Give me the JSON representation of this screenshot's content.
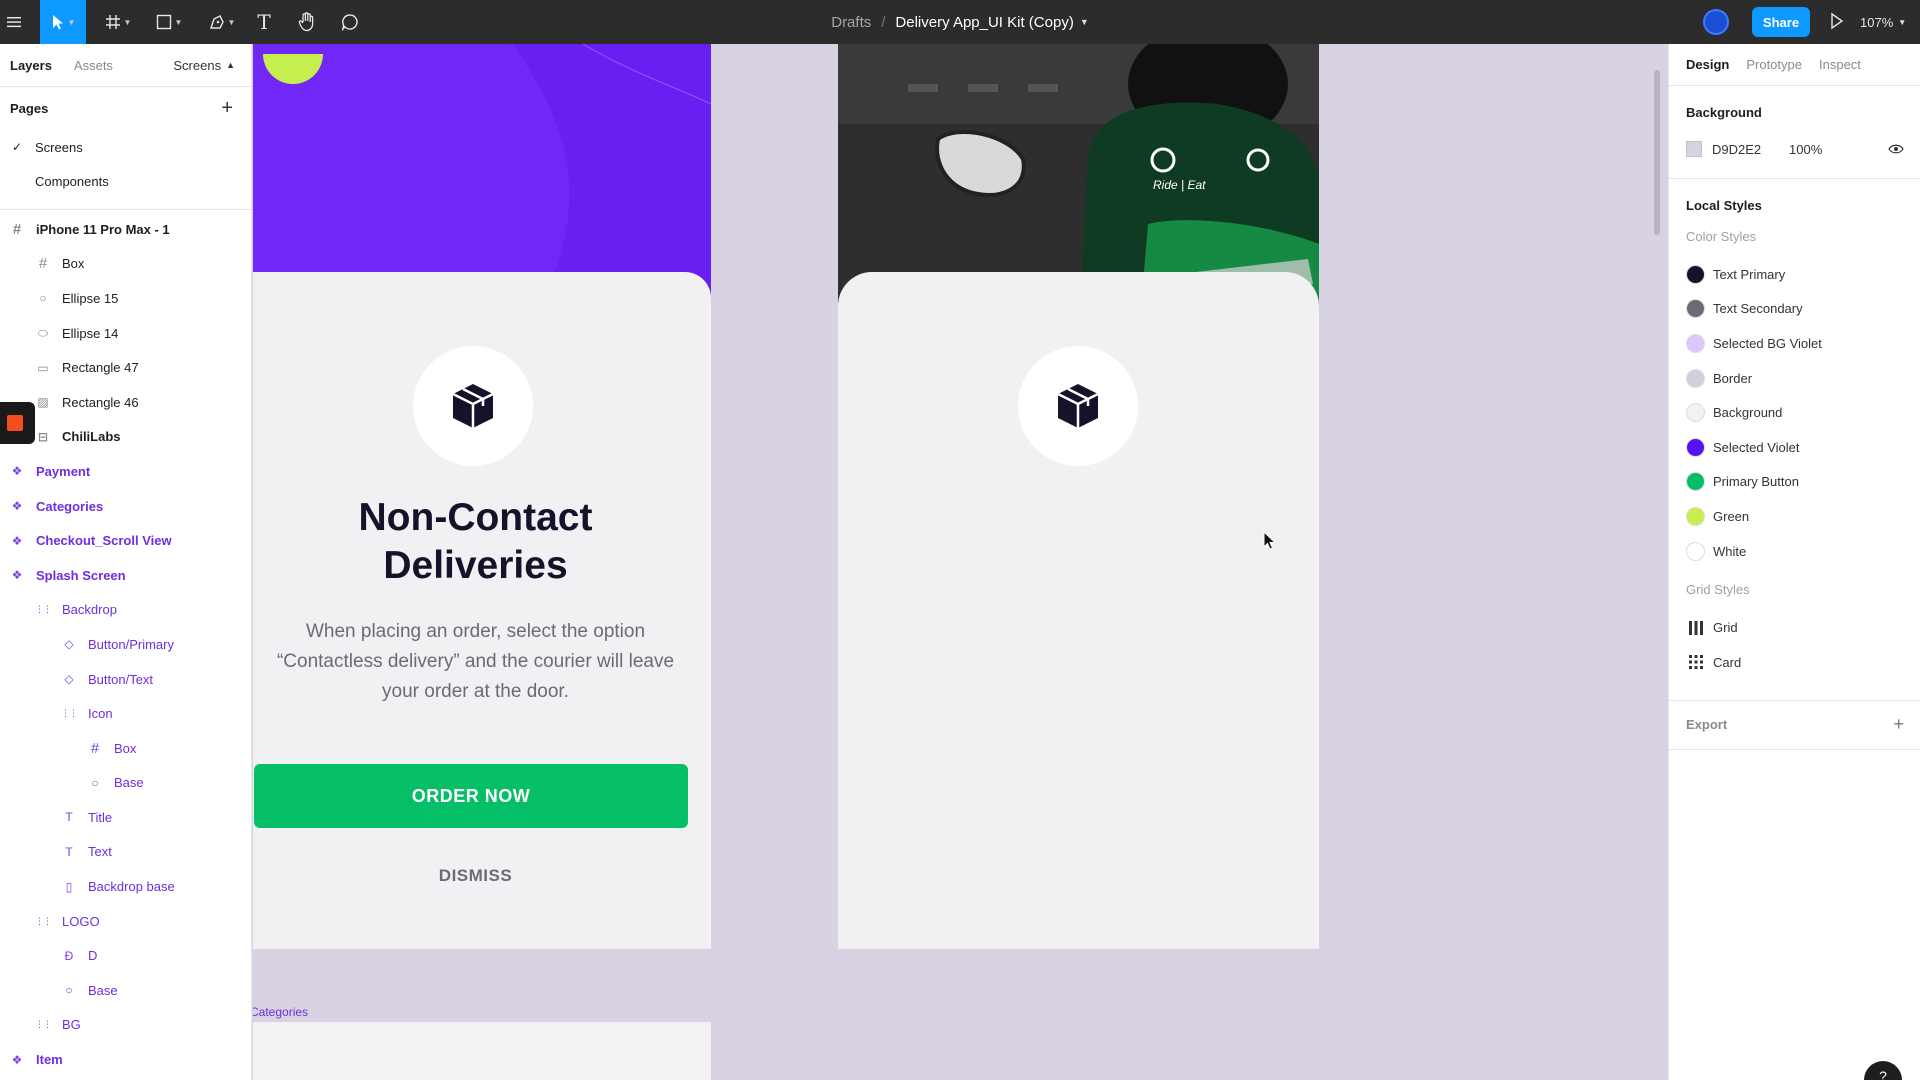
{
  "toolbar": {
    "breadcrumb_parent": "Drafts",
    "breadcrumb_sep": "/",
    "file_name": "Delivery App_UI Kit (Copy)",
    "share_label": "Share",
    "zoom": "107%"
  },
  "left_panel": {
    "tabs": [
      "Layers",
      "Assets"
    ],
    "page_selector": "Screens",
    "pages_title": "Pages",
    "pages": [
      {
        "label": "Screens",
        "selected": true
      },
      {
        "label": "Components",
        "selected": false
      }
    ],
    "layers": [
      {
        "label": "iPhone 11 Pro Max - 1",
        "icon": "frame-icon",
        "indent": 0,
        "style": "bold"
      },
      {
        "label": "Box",
        "icon": "frame-icon",
        "indent": 1,
        "style": "normal"
      },
      {
        "label": "Ellipse 15",
        "icon": "ellipse-icon",
        "indent": 1,
        "style": "normal"
      },
      {
        "label": "Ellipse 14",
        "icon": "ellipse-flat-icon",
        "indent": 1,
        "style": "normal"
      },
      {
        "label": "Rectangle 47",
        "icon": "rectangle-icon",
        "indent": 1,
        "style": "normal"
      },
      {
        "label": "Rectangle 46",
        "icon": "image-icon",
        "indent": 1,
        "style": "normal"
      },
      {
        "label": "ChiliLabs",
        "icon": "group-icon",
        "indent": 1,
        "style": "bold"
      },
      {
        "label": "Payment",
        "icon": "component-icon",
        "indent": 0,
        "style": "comp-bold"
      },
      {
        "label": "Categories",
        "icon": "component-icon",
        "indent": 0,
        "style": "comp-bold"
      },
      {
        "label": "Checkout_Scroll View",
        "icon": "component-icon",
        "indent": 0,
        "style": "comp-bold"
      },
      {
        "label": "Splash Screen",
        "icon": "component-icon",
        "indent": 0,
        "style": "comp-bold"
      },
      {
        "label": "Backdrop",
        "icon": "autolayout-icon",
        "indent": 1,
        "style": "comp"
      },
      {
        "label": "Button/Primary",
        "icon": "instance-icon",
        "indent": 2,
        "style": "comp"
      },
      {
        "label": "Button/Text",
        "icon": "instance-icon",
        "indent": 2,
        "style": "comp"
      },
      {
        "label": "Icon",
        "icon": "autolayout-icon",
        "indent": 2,
        "style": "comp"
      },
      {
        "label": "Box",
        "icon": "frame-icon",
        "indent": 3,
        "style": "comp"
      },
      {
        "label": "Base",
        "icon": "ellipse-icon",
        "indent": 3,
        "style": "comp"
      },
      {
        "label": "Title",
        "icon": "text-icon",
        "indent": 2,
        "style": "comp"
      },
      {
        "label": "Text",
        "icon": "text-icon",
        "indent": 2,
        "style": "comp"
      },
      {
        "label": "Backdrop base",
        "icon": "rectangle-tall-icon",
        "indent": 2,
        "style": "comp"
      },
      {
        "label": "LOGO",
        "icon": "autolayout-icon",
        "indent": 1,
        "style": "comp"
      },
      {
        "label": "D",
        "icon": "vector-icon",
        "indent": 2,
        "style": "comp"
      },
      {
        "label": "Base",
        "icon": "ellipse-icon",
        "indent": 2,
        "style": "comp"
      },
      {
        "label": "BG",
        "icon": "autolayout-icon",
        "indent": 1,
        "style": "comp"
      },
      {
        "label": "Item",
        "icon": "component-icon",
        "indent": 0,
        "style": "comp-bold"
      }
    ]
  },
  "canvas": {
    "splash": {
      "title_line1": "Non-Contact",
      "title_line2": "Deliveries",
      "text_line1": "When placing an order, select the option",
      "text_line2": "“Contactless delivery” and the courier will leave",
      "text_line3": "your order at the door.",
      "primary_button": "ORDER NOW",
      "text_button": "DISMISS"
    },
    "photo_jacket_text": "Ride | Eat",
    "categories_label": "Categories"
  },
  "right_panel": {
    "tabs": [
      "Design",
      "Prototype",
      "Inspect"
    ],
    "background_title": "Background",
    "background_hex": "D9D2E2",
    "background_opacity": "100%",
    "local_styles_title": "Local Styles",
    "color_styles_title": "Color Styles",
    "color_styles": [
      {
        "name": "Text Primary",
        "color": "#15122a"
      },
      {
        "name": "Text Secondary",
        "color": "#6c6a75"
      },
      {
        "name": "Selected BG Violet",
        "color": "#d8c8fb"
      },
      {
        "name": "Border",
        "color": "#d4cddd"
      },
      {
        "name": "Background",
        "color": "#f2f1f4"
      },
      {
        "name": "Selected Violet",
        "color": "#5613f0"
      },
      {
        "name": "Primary Button",
        "color": "#05bf67"
      },
      {
        "name": "Green",
        "color": "#c6ee4e"
      },
      {
        "name": "White",
        "color": "#ffffff"
      }
    ],
    "grid_styles_title": "Grid Styles",
    "grid_styles": [
      {
        "name": "Grid",
        "icon": "columns-grid-icon"
      },
      {
        "name": "Card",
        "icon": "dots-grid-icon"
      }
    ],
    "export_title": "Export"
  },
  "colors": {
    "accent": "#0d99ff",
    "component_purple": "#6f2ee0",
    "canvas_bg": "#D9D2E2",
    "splash_violet": "#7127f7"
  }
}
